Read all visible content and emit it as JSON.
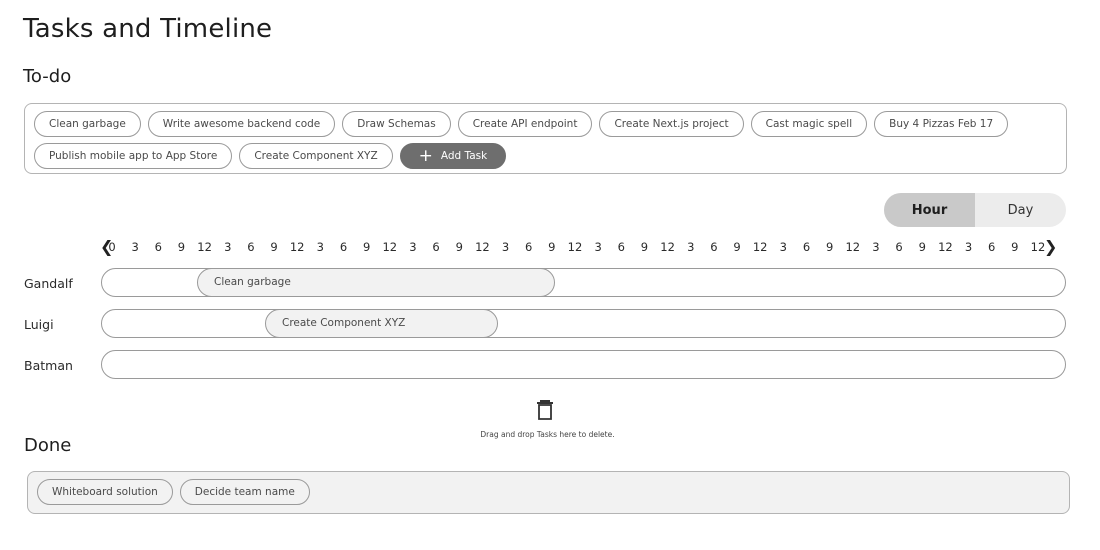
{
  "page": {
    "title": "Tasks and Timeline"
  },
  "todo": {
    "title": "To-do",
    "tasks": [
      "Clean garbage",
      "Write awesome backend code",
      "Draw Schemas",
      "Create API endpoint",
      "Create Next.js project",
      "Cast magic spell",
      "Buy 4 Pizzas Feb 17",
      "Publish mobile app to App Store",
      "Create Component XYZ"
    ],
    "add_label": "Add Task"
  },
  "view_toggle": {
    "hour_label": "Hour",
    "day_label": "Day",
    "active": "Hour"
  },
  "timeline": {
    "ticks": [
      "0",
      "3",
      "6",
      "9",
      "12",
      "3",
      "6",
      "9",
      "12",
      "3",
      "6",
      "9",
      "12",
      "3",
      "6",
      "9",
      "12",
      "3",
      "6",
      "9",
      "12",
      "3",
      "6",
      "9",
      "12",
      "3",
      "6",
      "9",
      "12",
      "3",
      "6",
      "9",
      "12",
      "3",
      "6",
      "9",
      "12",
      "3",
      "6",
      "9",
      "12"
    ],
    "rows": [
      {
        "name": "Gandalf",
        "task": "Clean garbage"
      },
      {
        "name": "Luigi",
        "task": "Create Component XYZ"
      },
      {
        "name": "Batman",
        "task": ""
      }
    ]
  },
  "trash": {
    "icon": "trash-icon",
    "hint": "Drag and drop Tasks here to delete."
  },
  "done": {
    "title": "Done",
    "tasks": [
      "Whiteboard solution",
      "Decide team name"
    ]
  }
}
